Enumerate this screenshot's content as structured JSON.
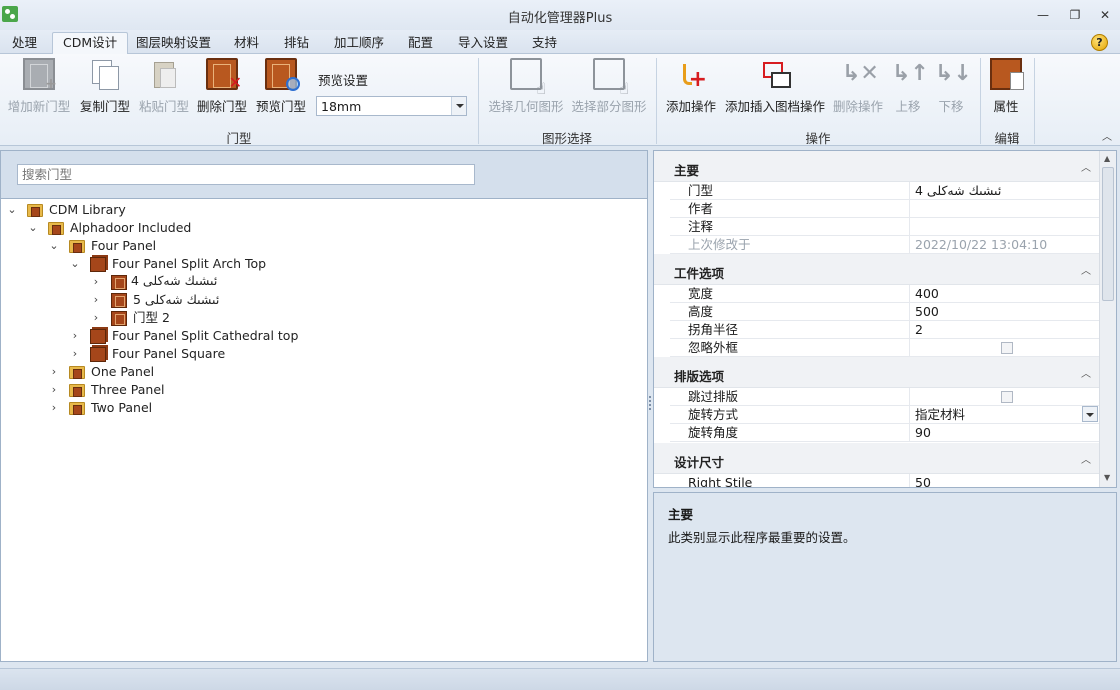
{
  "window": {
    "title": "自动化管理器Plus",
    "controls": {
      "minimize": "—",
      "restore": "❐",
      "close": "✕"
    }
  },
  "tabs": [
    {
      "label": "处理",
      "active": false
    },
    {
      "label": "CDM设计",
      "active": true
    },
    {
      "label": "图层映射设置",
      "active": false
    },
    {
      "label": "材料",
      "active": false
    },
    {
      "label": "排钻",
      "active": false
    },
    {
      "label": "加工顺序",
      "active": false
    },
    {
      "label": "配置",
      "active": false
    },
    {
      "label": "导入设置",
      "active": false
    },
    {
      "label": "支持",
      "active": false
    }
  ],
  "help_glyph": "?",
  "ribbon": {
    "door_group": {
      "label": "门型",
      "buttons": [
        {
          "label": "增加新门型",
          "icon": "add-door-icon",
          "enabled": false
        },
        {
          "label": "复制门型",
          "icon": "copy-icon",
          "enabled": true
        },
        {
          "label": "粘贴门型",
          "icon": "paste-icon",
          "enabled": false
        },
        {
          "label": "删除门型",
          "icon": "delete-door-icon",
          "enabled": true
        },
        {
          "label": "预览门型",
          "icon": "preview-door-icon",
          "enabled": true
        }
      ],
      "preview_setting_label": "预览设置",
      "preview_value": "18mm"
    },
    "shape_group": {
      "label": "图形选择",
      "buttons": [
        {
          "label": "选择几何图形",
          "icon": "select-geometry-icon",
          "enabled": false
        },
        {
          "label": "选择部分图形",
          "icon": "select-partial-icon",
          "enabled": false
        }
      ]
    },
    "operation_group": {
      "label": "操作",
      "buttons": [
        {
          "label": "添加操作",
          "icon": "add-operation-icon",
          "enabled": true
        },
        {
          "label": "添加插入图档操作",
          "icon": "insert-file-operation-icon",
          "enabled": true
        },
        {
          "label": "删除操作",
          "icon": "delete-operation-icon",
          "enabled": false
        },
        {
          "label": "上移",
          "icon": "move-up-icon",
          "enabled": false
        },
        {
          "label": "下移",
          "icon": "move-down-icon",
          "enabled": false
        }
      ]
    },
    "edit_group": {
      "label": "编辑",
      "buttons": [
        {
          "label": "属性",
          "icon": "properties-icon",
          "enabled": true
        }
      ]
    }
  },
  "search": {
    "placeholder": "搜索门型"
  },
  "tree": [
    {
      "label": "CDM Library",
      "level": 0,
      "expanded": true,
      "icon": "folder"
    },
    {
      "label": "Alphadoor Included",
      "level": 1,
      "expanded": true,
      "icon": "folder"
    },
    {
      "label": "Four Panel",
      "level": 2,
      "expanded": true,
      "icon": "folder"
    },
    {
      "label": "Four Panel Split Arch Top",
      "level": 3,
      "expanded": true,
      "icon": "stack"
    },
    {
      "label": "ئىشىك شەكلى 4",
      "level": 4,
      "expanded": false,
      "icon": "door",
      "selected": true
    },
    {
      "label": "ئىشىك شەكلى 5",
      "level": 4,
      "expanded": false,
      "icon": "door"
    },
    {
      "label": "门型 2",
      "level": 4,
      "expanded": false,
      "icon": "door"
    },
    {
      "label": "Four Panel Split Cathedral top",
      "level": 3,
      "expanded": false,
      "icon": "stack"
    },
    {
      "label": "Four Panel Square",
      "level": 3,
      "expanded": false,
      "icon": "stack"
    },
    {
      "label": "One Panel",
      "level": 2,
      "expanded": false,
      "icon": "folder"
    },
    {
      "label": "Three Panel",
      "level": 2,
      "expanded": false,
      "icon": "folder"
    },
    {
      "label": "Two Panel",
      "level": 2,
      "expanded": false,
      "icon": "folder"
    }
  ],
  "properties": {
    "main": {
      "title": "主要",
      "rows": [
        {
          "name": "门型",
          "value": "ئىشىك شەكلى 4"
        },
        {
          "name": "作者",
          "value": ""
        },
        {
          "name": "注释",
          "value": ""
        },
        {
          "name": "上次修改于",
          "value": "2022/10/22 13:04:10",
          "disabled": true
        }
      ]
    },
    "part": {
      "title": "工件选项",
      "rows": [
        {
          "name": "宽度",
          "value": "400"
        },
        {
          "name": "高度",
          "value": "500"
        },
        {
          "name": "拐角半径",
          "value": "2"
        },
        {
          "name": "忽略外框",
          "value": "",
          "checkbox": true,
          "checked": false
        }
      ]
    },
    "nesting": {
      "title": "排版选项",
      "rows": [
        {
          "name": "跳过排版",
          "value": "",
          "checkbox": true,
          "checked": false
        },
        {
          "name": "旋转方式",
          "value": "指定材料",
          "dropdown": true
        },
        {
          "name": "旋转角度",
          "value": "90"
        }
      ]
    },
    "design": {
      "title": "设计尺寸",
      "rows": [
        {
          "name": "Right Stile",
          "value": "50"
        }
      ]
    }
  },
  "help_panel": {
    "title": "主要",
    "text": "此类别显示此程序最重要的设置。"
  }
}
